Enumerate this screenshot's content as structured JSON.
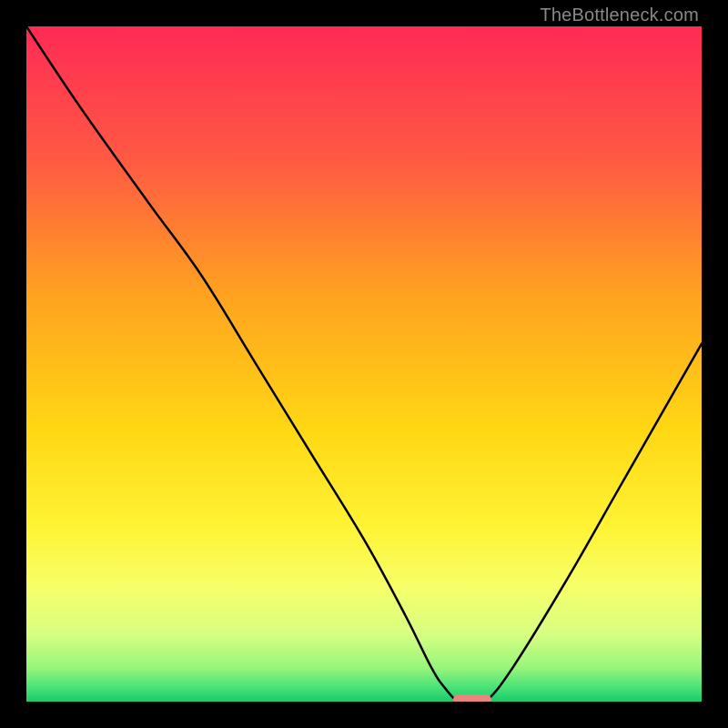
{
  "watermark": "TheBottleneck.com",
  "chart_data": {
    "type": "line",
    "title": "",
    "xlabel": "",
    "ylabel": "",
    "xlim": [
      0,
      100
    ],
    "ylim": [
      0,
      100
    ],
    "series": [
      {
        "name": "bottleneck-curve",
        "x": [
          0,
          8,
          18,
          26,
          34,
          42,
          50,
          56,
          60,
          62,
          64,
          66,
          68,
          72,
          80,
          88,
          96,
          100
        ],
        "y": [
          100,
          88,
          74,
          63,
          50,
          37,
          24,
          13,
          5,
          2,
          0,
          0,
          0,
          5,
          18,
          32,
          46,
          53
        ]
      }
    ],
    "optimal_marker": {
      "x_start": 64,
      "x_end": 68,
      "y": 0
    },
    "gradient_stops": [
      {
        "pct": 0,
        "color": "#ff2a55"
      },
      {
        "pct": 20,
        "color": "#ff5a43"
      },
      {
        "pct": 40,
        "color": "#ffa31f"
      },
      {
        "pct": 60,
        "color": "#ffd814"
      },
      {
        "pct": 74,
        "color": "#fff334"
      },
      {
        "pct": 83,
        "color": "#f7ff69"
      },
      {
        "pct": 90,
        "color": "#d7ff82"
      },
      {
        "pct": 95,
        "color": "#97f57a"
      },
      {
        "pct": 98,
        "color": "#46e277"
      },
      {
        "pct": 100,
        "color": "#19c96b"
      }
    ]
  }
}
